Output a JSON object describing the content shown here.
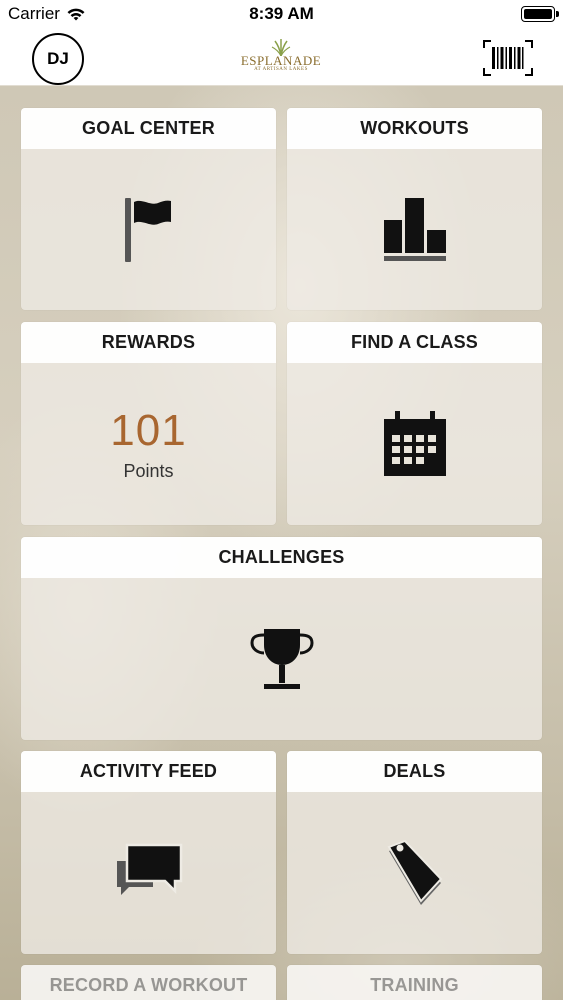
{
  "status_bar": {
    "carrier": "Carrier",
    "time": "8:39 AM",
    "wifi_icon": "wifi-icon",
    "battery_icon": "battery-icon"
  },
  "nav": {
    "avatar_initials": "DJ",
    "logo_name": "ESPLANADE",
    "logo_subtitle": "AT ARTISAN LAKES",
    "barcode_icon": "barcode-scan-icon"
  },
  "tiles": {
    "goal_center": {
      "title": "GOAL CENTER",
      "icon": "flag-icon"
    },
    "workouts": {
      "title": "WORKOUTS",
      "icon": "bar-chart-icon"
    },
    "rewards": {
      "title": "REWARDS",
      "points": "101",
      "points_label": "Points"
    },
    "find_a_class": {
      "title": "FIND A CLASS",
      "icon": "calendar-icon"
    },
    "challenges": {
      "title": "CHALLENGES",
      "icon": "trophy-icon"
    },
    "activity_feed": {
      "title": "ACTIVITY FEED",
      "icon": "chat-bubbles-icon"
    },
    "deals": {
      "title": "DEALS",
      "icon": "tag-icon"
    },
    "record_a_workout": {
      "title": "RECORD A WORKOUT"
    },
    "training": {
      "title": "TRAINING"
    }
  },
  "colors": {
    "points_accent": "#a86630",
    "logo_gold": "#8a6d2e",
    "header_bg": "#ffffff",
    "tile_body_bg": "#eeebe4"
  }
}
